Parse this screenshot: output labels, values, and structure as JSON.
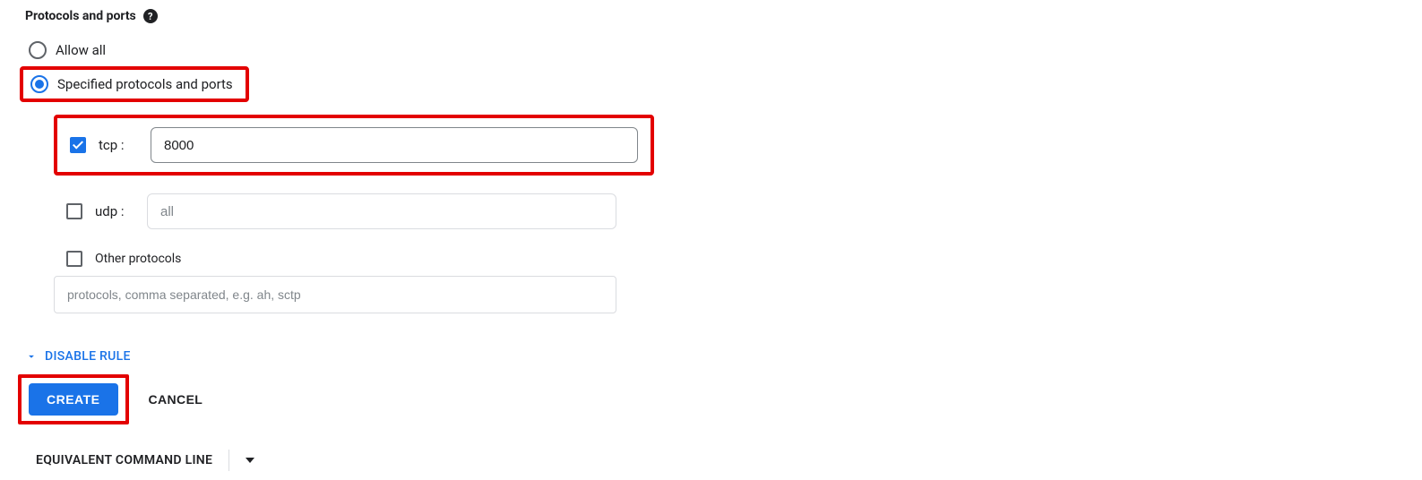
{
  "section": {
    "title": "Protocols and ports"
  },
  "radios": {
    "allow_all": "Allow all",
    "specified": "Specified protocols and ports"
  },
  "tcp": {
    "label": "tcp :",
    "value": "8000"
  },
  "udp": {
    "label": "udp :",
    "placeholder": "all"
  },
  "other": {
    "label": "Other protocols",
    "placeholder": "protocols, comma separated, e.g. ah, sctp"
  },
  "disable_rule": "DISABLE RULE",
  "buttons": {
    "create": "CREATE",
    "cancel": "CANCEL"
  },
  "equivalent": "EQUIVALENT COMMAND LINE"
}
